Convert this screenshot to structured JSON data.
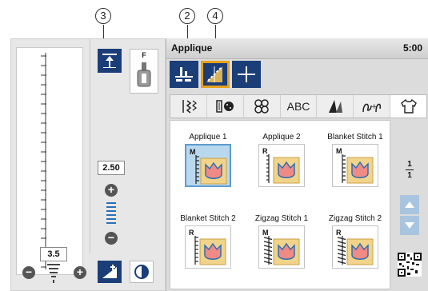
{
  "callouts": [
    "3",
    "2",
    "4"
  ],
  "left_panel": {
    "presser_foot": "F",
    "stitch_width": "2.50",
    "stitch_length": "3.5"
  },
  "header": {
    "mode_title": "Applique",
    "clock": "5:00"
  },
  "tabs": [
    {
      "icon": "utility-stitch-icon",
      "label": ""
    },
    {
      "icon": "buttonhole-icon",
      "label": ""
    },
    {
      "icon": "decorative-stitch-icon",
      "label": ""
    },
    {
      "icon": "character-stitch-icon",
      "label": "ABC"
    },
    {
      "icon": "quilting-stitch-icon",
      "label": ""
    },
    {
      "icon": "combination-stitch-icon",
      "label": ""
    },
    {
      "icon": "garment-icon",
      "label": ""
    }
  ],
  "stitches": [
    {
      "label": "Applique 1",
      "foot": "M",
      "selected": true
    },
    {
      "label": "Applique 2",
      "foot": "R",
      "selected": false
    },
    {
      "label": "Blanket Stitch 1",
      "foot": "M",
      "selected": false
    },
    {
      "label": "Blanket Stitch 2",
      "foot": "R",
      "selected": false
    },
    {
      "label": "Zigzag Stitch 1",
      "foot": "M",
      "selected": false
    },
    {
      "label": "Zigzag Stitch 2",
      "foot": "R",
      "selected": false
    }
  ],
  "pagination": {
    "current": "1",
    "total": "1"
  },
  "colors": {
    "button_blue": "#1b3d78",
    "selection_orange": "#e5a21a",
    "selected_cell": "#b9d8ee"
  }
}
